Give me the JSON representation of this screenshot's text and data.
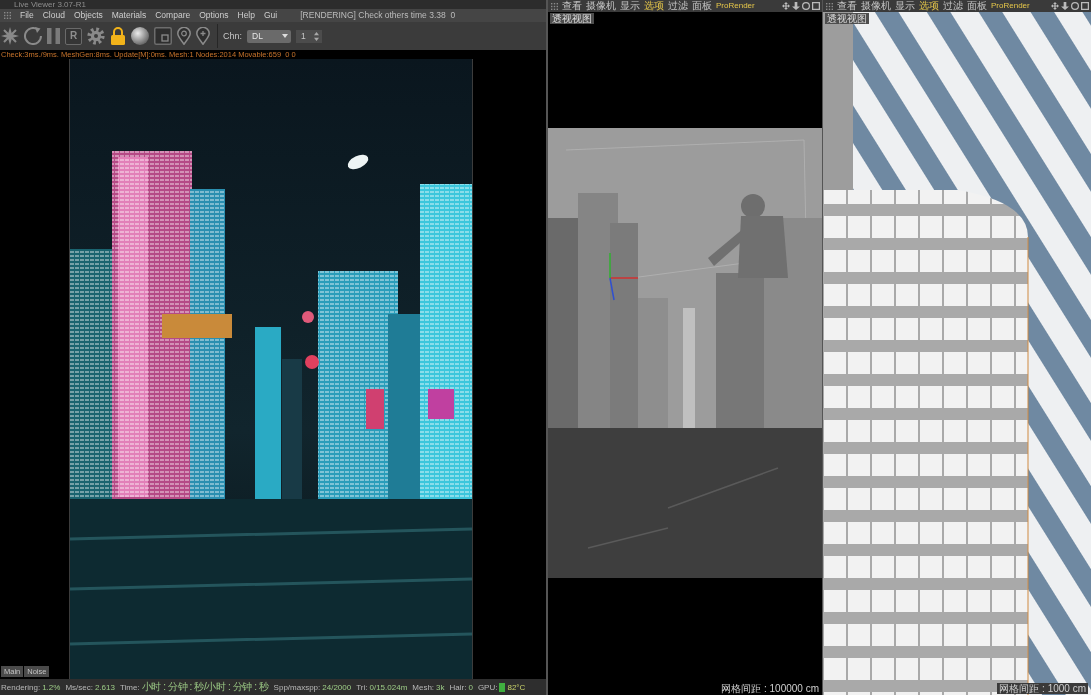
{
  "render_window": {
    "title": "Live Viewer 3.07-R1",
    "menu": [
      "File",
      "Cloud",
      "Objects",
      "Materials",
      "Compare",
      "Options",
      "Help",
      "Gui"
    ],
    "render_status": "[RENDERING] Check others time 3.38  0",
    "toolbar": {
      "lock_on": true,
      "boxed_letter": "R",
      "channel": {
        "label": "Chn:",
        "value": "DL"
      },
      "pass_value": "1"
    },
    "stats": "Check:3ms./9ms. MeshGen:8ms. Update[M]:0ms. Mesh:1 Nodes:2014 Movable:659  0 0",
    "tabs": [
      {
        "label": "Main"
      },
      {
        "label": "Noise"
      }
    ],
    "status_bar": [
      {
        "kind": "plain",
        "label": "Rendering:",
        "value": "1.2%"
      },
      {
        "kind": "plain",
        "label": "Ms/sec:",
        "value": "2.613"
      },
      {
        "kind": "plain",
        "label": "Time:",
        "value": "小时 : 分钟 : 秒/小时 : 分钟 : 秒"
      },
      {
        "kind": "plain",
        "label": "Spp/maxspp:",
        "value": "24/2000"
      },
      {
        "kind": "plain",
        "label": "Tri:",
        "value": "0/15.024m"
      },
      {
        "kind": "plain",
        "label": "Mesh:",
        "value": "3k"
      },
      {
        "kind": "plain",
        "label": "Hair:",
        "value": "0"
      },
      {
        "kind": "gpu",
        "label": "GPU:",
        "value": "82°C"
      }
    ]
  },
  "viewports": [
    {
      "kind": "city_scene",
      "menu": [
        {
          "label": "查看",
          "highlighted": false
        },
        {
          "label": "摄像机",
          "highlighted": false
        },
        {
          "label": "显示",
          "highlighted": false
        },
        {
          "label": "选项",
          "highlighted": true
        },
        {
          "label": "过滤",
          "highlighted": false
        },
        {
          "label": "面板",
          "highlighted": false
        },
        {
          "label": "ProRender",
          "highlighted": true
        }
      ],
      "title": "透视视图",
      "grid_spacing": "网格间距 : 100000 cm"
    },
    {
      "kind": "building_closeup",
      "menu": [
        {
          "label": "查看",
          "highlighted": false
        },
        {
          "label": "摄像机",
          "highlighted": false
        },
        {
          "label": "显示",
          "highlighted": false
        },
        {
          "label": "选项",
          "highlighted": true
        },
        {
          "label": "过滤",
          "highlighted": false
        },
        {
          "label": "面板",
          "highlighted": false
        },
        {
          "label": "ProRender",
          "highlighted": true
        }
      ],
      "title": "透视视图",
      "grid_spacing": "网格间距 : 1000 cm"
    }
  ]
}
